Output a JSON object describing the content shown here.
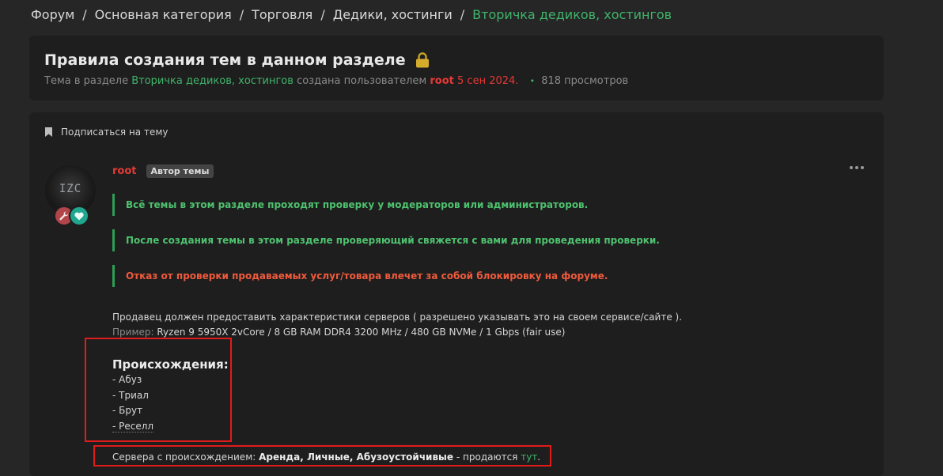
{
  "breadcrumb": {
    "items": [
      "Форум",
      "Основная категория",
      "Торговля",
      "Дедики, хостинги"
    ],
    "current": "Вторичка дедиков, хостингов",
    "separator": "/"
  },
  "thread": {
    "title": "Правила создания тем в данном разделе",
    "meta_prefix": "Тема в разделе",
    "section": "Вторичка дедиков, хостингов",
    "created_by": "создана пользователем",
    "author": "root",
    "date": "5 сен 2024.",
    "views": "818 просмотров"
  },
  "post": {
    "subscribe_label": "Подписаться на тему",
    "avatar_text": "IZC",
    "author": "root",
    "author_tag": "Автор темы",
    "notices": [
      {
        "text": "Всё темы в этом разделе проходят проверку у модераторов или администраторов.",
        "tone": "green"
      },
      {
        "text": "После создания темы в этом разделе проверяющий свяжется с вами для проведения проверки.",
        "tone": "green"
      },
      {
        "text": "Отказ от проверки продаваемых услуг/товара влечет за собой блокировку на форуме.",
        "tone": "red"
      }
    ],
    "seller_text": "Продавец должен предоставить характеристики серверов ( разрешено указывать это на своем сервисе/сайте ).",
    "example_label": "Пример:",
    "example_value": " Ryzen 9 5950X 2vCore / 8 GB RAM DDR4 3200 MHz / 480 GB NVMe / 1 Gbps (fair use)",
    "origins_title": "Происхождения:",
    "origins": [
      "- Абуз",
      "- Триал",
      "- Брут",
      "- Реселл"
    ],
    "servers_prefix": "Сервера с происхождением: ",
    "servers_bold": "Аренда, Личные, Абузоустойчивые",
    "servers_mid": " - продаются ",
    "servers_link": "тут",
    "servers_end": "."
  },
  "colors": {
    "accent_green": "#3fb56a",
    "user_red": "#e53935",
    "notice_red": "#f05a3c",
    "highlight_box": "#e21b1b"
  },
  "icons": [
    "lock-icon",
    "bookmark-icon",
    "wrench-icon",
    "heart-icon",
    "more-icon"
  ]
}
